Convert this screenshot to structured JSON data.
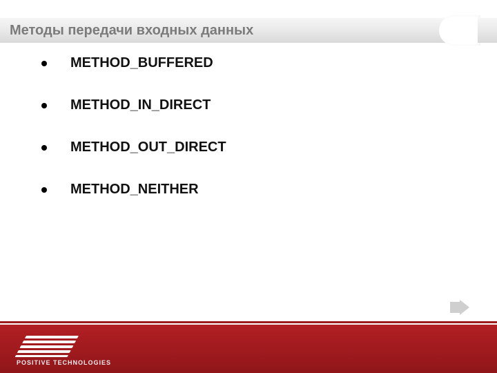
{
  "header": {
    "title": "Методы передачи входных данных"
  },
  "bullets": [
    {
      "text": "METHOD_BUFFERED"
    },
    {
      "text": "METHOD_IN_DIRECT"
    },
    {
      "text": "METHOD_OUT_DIRECT"
    },
    {
      "text": "METHOD_NEITHER"
    }
  ],
  "footer": {
    "brand": "POSITIVE TECHNOLOGIES"
  },
  "icons": {
    "next": "next-arrow-icon",
    "logo": "positive-technologies-logo"
  }
}
